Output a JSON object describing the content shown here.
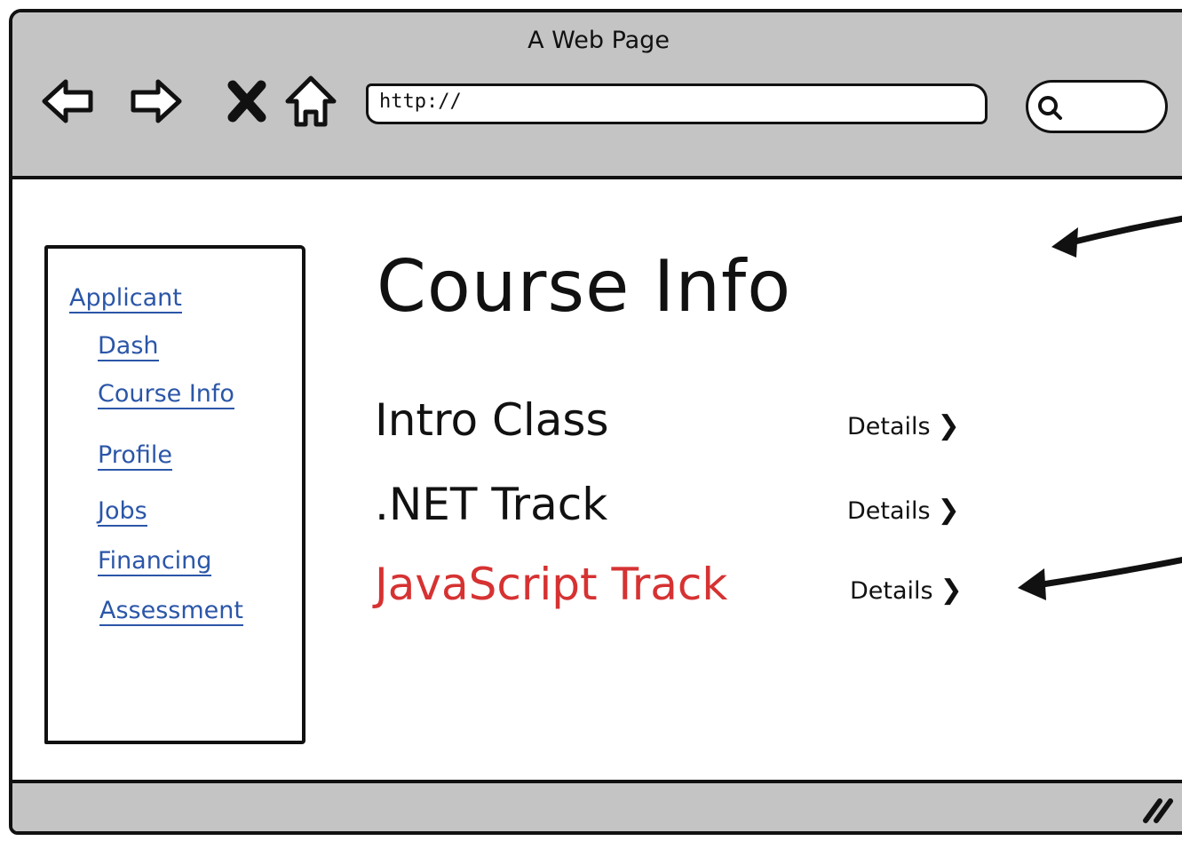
{
  "window": {
    "title": "A Web Page",
    "address_value": "http://"
  },
  "sidebar": {
    "items": [
      {
        "label": "Applicant"
      },
      {
        "label": "Dash"
      },
      {
        "label": "Course Info"
      },
      {
        "label": "Profile"
      },
      {
        "label": "Jobs"
      },
      {
        "label": "Financing"
      },
      {
        "label": "Assessment"
      }
    ]
  },
  "main": {
    "title": "Course Info",
    "courses": [
      {
        "name": "Intro Class",
        "details_label": "Details",
        "highlighted": false
      },
      {
        "name": ".NET Track",
        "details_label": "Details",
        "highlighted": false
      },
      {
        "name": "JavaScript Track",
        "details_label": "Details",
        "highlighted": true
      }
    ]
  },
  "colors": {
    "chrome": "#c4c4c4",
    "link": "#2b56a8",
    "highlight": "#d63232",
    "ink": "#111111"
  },
  "icons": {
    "back": "arrow-left-icon",
    "forward": "arrow-right-icon",
    "stop": "close-icon",
    "home": "home-icon",
    "search": "search-icon",
    "resize": "resize-grip-icon",
    "annotation": "annotation-arrow-icon"
  }
}
